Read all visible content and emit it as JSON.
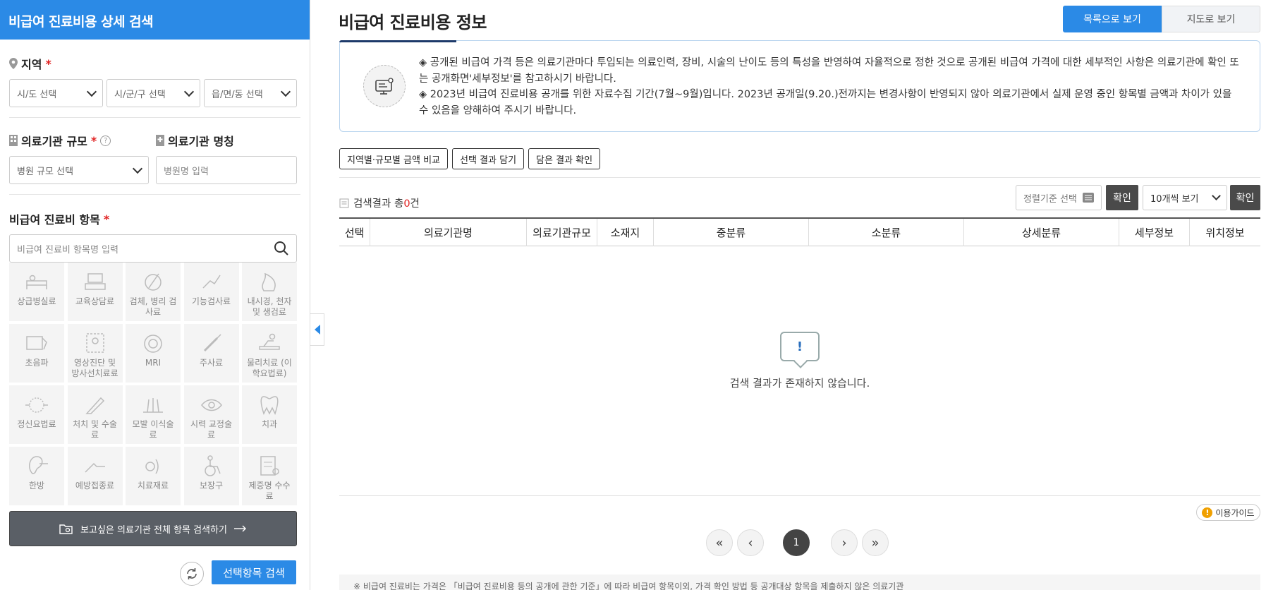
{
  "sidebar": {
    "title": "비급여 진료비용 상세 검색",
    "region": {
      "label": "지역",
      "required_mark": "*",
      "sido_placeholder": "시/도 선택",
      "sigungu_placeholder": "시/군/구 선택",
      "eupmyeondong_placeholder": "읍/면/동 선택"
    },
    "scale": {
      "label": "의료기관 규모",
      "required_mark": "*",
      "help": "?",
      "placeholder": "병원 규모 선택"
    },
    "hospital_name": {
      "label": "의료기관 명칭",
      "placeholder": "병원명 입력"
    },
    "items": {
      "label": "비급여 진료비 항목",
      "required_mark": "*",
      "search_placeholder": "비급여 진료비 항목명 입력",
      "categories": [
        {
          "label": "상급병실료",
          "icon": "hospital-bed-icon"
        },
        {
          "label": "교육상담료",
          "icon": "counseling-icon"
        },
        {
          "label": "검체, 병리 검사료",
          "icon": "specimen-test-icon"
        },
        {
          "label": "기능검사료",
          "icon": "function-test-icon"
        },
        {
          "label": "내시경, 천자 및 생검료",
          "icon": "endoscope-icon"
        },
        {
          "label": "초음파",
          "icon": "ultrasound-icon"
        },
        {
          "label": "영상진단 및 방사선치료료",
          "icon": "radiology-icon"
        },
        {
          "label": "MRI",
          "icon": "mri-icon"
        },
        {
          "label": "주사료",
          "icon": "syringe-icon"
        },
        {
          "label": "물리치료 (이학요법료)",
          "icon": "physical-therapy-icon"
        },
        {
          "label": "정신요법료",
          "icon": "brain-icon"
        },
        {
          "label": "처치 및 수술료",
          "icon": "scalpel-icon"
        },
        {
          "label": "모발 이식술료",
          "icon": "hair-icon"
        },
        {
          "label": "시력 교정술료",
          "icon": "eye-icon"
        },
        {
          "label": "치과",
          "icon": "tooth-icon"
        },
        {
          "label": "한방",
          "icon": "ear-acupuncture-icon"
        },
        {
          "label": "예방접종료",
          "icon": "vaccination-icon"
        },
        {
          "label": "치료재료",
          "icon": "treatment-material-icon"
        },
        {
          "label": "보장구",
          "icon": "wheelchair-icon"
        },
        {
          "label": "제증명 수수료",
          "icon": "certificate-icon"
        }
      ]
    },
    "all_items_button": "보고싶은 의료기관 전체 항목 검색하기",
    "search_button": "선택항목 검색"
  },
  "main": {
    "title": "비급여 진료비용 정보",
    "view_list": "목록으로 보기",
    "view_map": "지도로 보기",
    "notice_lines": [
      "◈ 공개된 비급여 가격 등은 의료기관마다 투입되는 의료인력, 장비, 시술의 난이도 등의 특성을 반영하여 자율적으로 정한 것으로 공개된 비급여 가격에 대한 세부적인 사항은 의료기관에 확인 또는 공개화면'세부정보'를 참고하시기 바랍니다.",
      "◈ 2023년 비급여 진료비용 공개를 위한 자료수집 기간(7월~9월)입니다. 2023년 공개일(9.20.)전까지는 변경사항이 반영되지 않아 의료기관에서 실제 운영 중인 항목별 금액과 차이가 있을 수 있음을 양해하여 주시기 바랍니다."
    ],
    "actions": [
      "지역별·규모별 금액 비교",
      "선택 결과 담기",
      "담은 결과 확인"
    ],
    "result_prefix": "검색결과 총",
    "result_count": "0",
    "result_suffix": "건",
    "sort_placeholder": "정렬기준 선택",
    "confirm": "확인",
    "per_page": "10개씩 보기",
    "columns": [
      "선택",
      "의료기관명",
      "의료기관규모",
      "소재지",
      "중분류",
      "소분류",
      "상세분류",
      "세부정보",
      "위치정보"
    ],
    "empty_mark": "!",
    "empty_message": "검색 결과가 존재하지 않습니다.",
    "guide": "이용가이드",
    "guide_mark": "!",
    "pagination": {
      "first": "«",
      "prev": "‹",
      "current": "1",
      "next": "›",
      "last": "»"
    },
    "footer_text": "※ 비급여 진료비는 가격은 「비급여 진료비용 등의 공개에 관한 기준」에 따라 비급여 항목이외, 가격 확인 방법 등 공개대상 항목을 제출하지 않은 의료기관"
  },
  "colors": {
    "primary": "#2b8ae6",
    "dark_button": "#4a4a4a",
    "required": "#e02020"
  }
}
